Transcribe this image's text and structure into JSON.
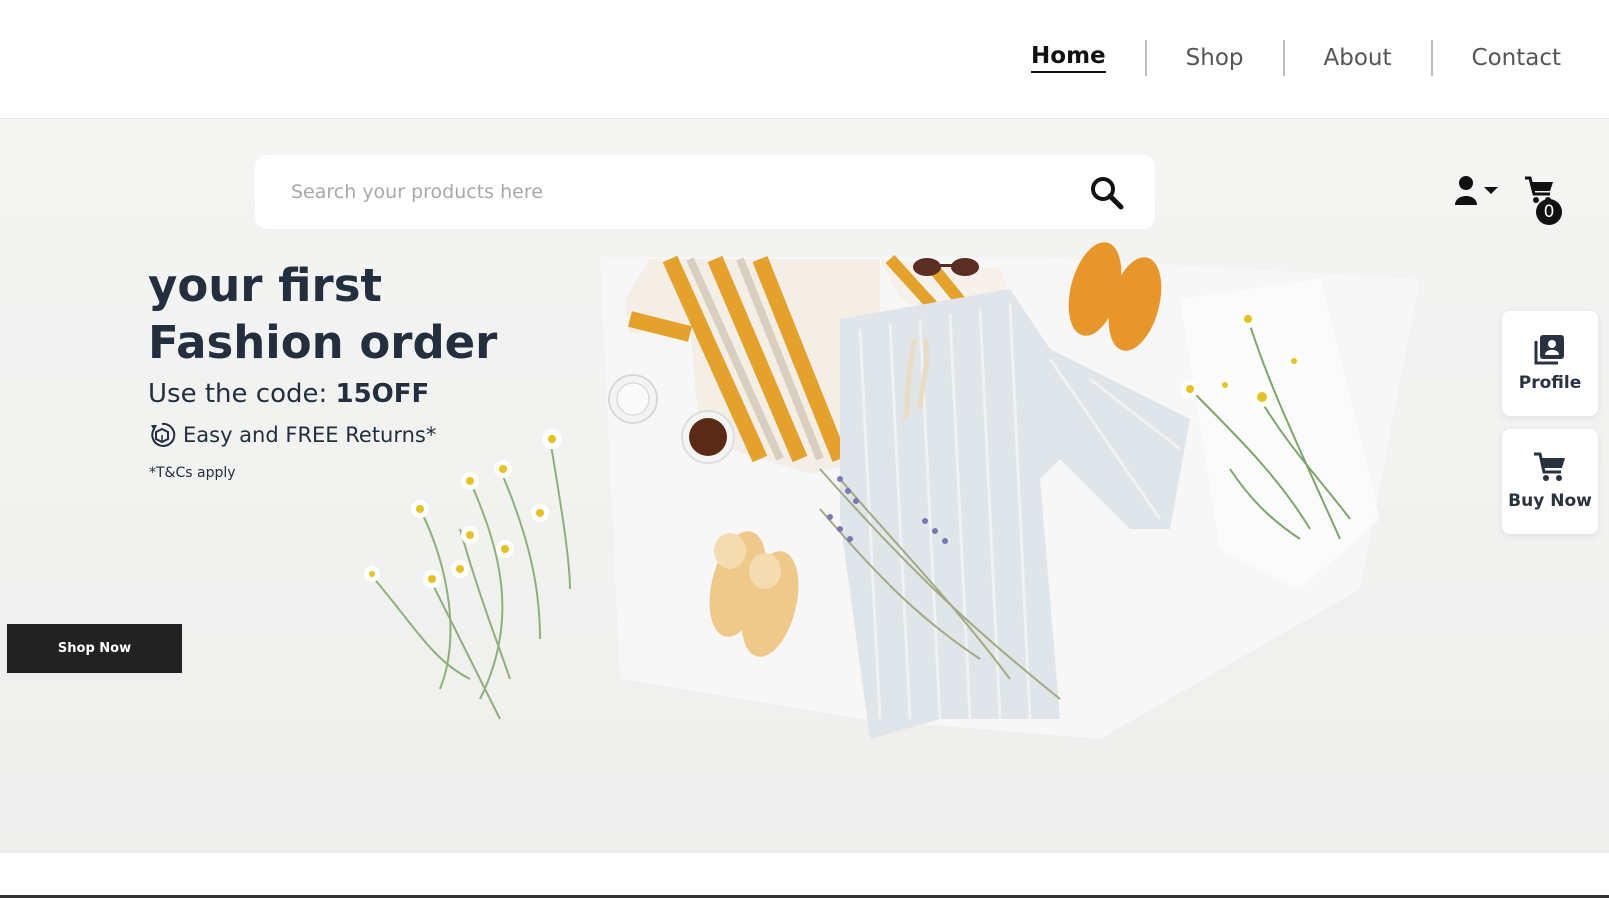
{
  "nav": {
    "items": [
      {
        "label": "Home",
        "active": true
      },
      {
        "label": "Shop",
        "active": false
      },
      {
        "label": "About",
        "active": false
      },
      {
        "label": "Contact",
        "active": false
      }
    ]
  },
  "search": {
    "placeholder": "Search your products here",
    "value": ""
  },
  "header_icons": {
    "user": "user-dropdown-icon",
    "cart": "cart-icon",
    "cart_count": "0"
  },
  "hero": {
    "line1": "your first",
    "line2": "Fashion order",
    "code_prefix": "Use the code: ",
    "code": "15OFF",
    "returns": "Easy and FREE Returns*",
    "terms": "*T&Cs apply",
    "cta": "Shop Now"
  },
  "side_actions": [
    {
      "label": "Profile",
      "icon": "profile-book-icon"
    },
    {
      "label": "Buy Now",
      "icon": "cart-icon"
    }
  ],
  "colors": {
    "text_dark": "#232f3e",
    "button_dark": "#222222",
    "stripe_orange": "#e4a12c",
    "shoe_orange": "#e8962a",
    "shoe_beige": "#efc98a"
  }
}
